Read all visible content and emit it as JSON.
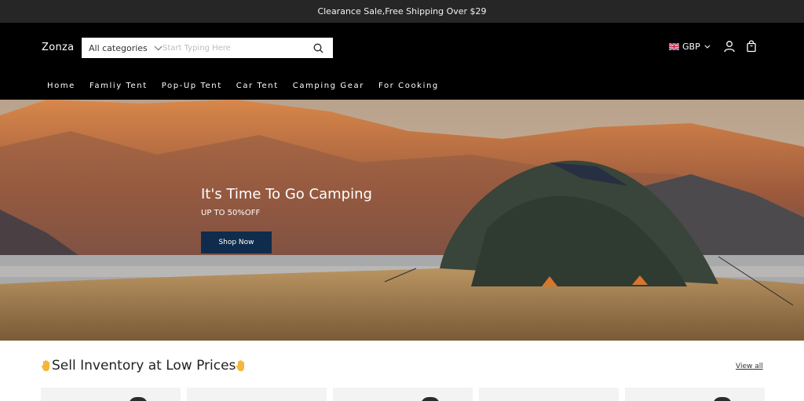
{
  "announcement": {
    "text": "Clearance Sale,Free Shipping Over $29"
  },
  "header": {
    "logo": "Zonza",
    "search": {
      "category_label": "All categories",
      "placeholder": "Start Typing Here",
      "value": ""
    },
    "currency": {
      "code": "GBP",
      "flag_icon": "uk-flag-icon"
    },
    "icons": [
      "search-icon",
      "account-icon",
      "cart-icon"
    ]
  },
  "nav": {
    "items": [
      {
        "label": "Home"
      },
      {
        "label": "Famliy Tent"
      },
      {
        "label": "Pop-Up Tent"
      },
      {
        "label": "Car Tent"
      },
      {
        "label": "Camping Gear"
      },
      {
        "label": "For Cooking"
      }
    ]
  },
  "hero": {
    "title": "It's Time To Go Camping",
    "subtitle": "UP TO 50%OFF",
    "button_label": "Shop Now",
    "button_color": "#0f2c4c"
  },
  "section": {
    "title": "Sell Inventory at Low Prices",
    "title_icon": "hand-icon",
    "view_all_label": "View all"
  },
  "colors": {
    "announcement_bg": "#262626",
    "header_bg": "#000000",
    "accent": "#0f2c4c"
  }
}
